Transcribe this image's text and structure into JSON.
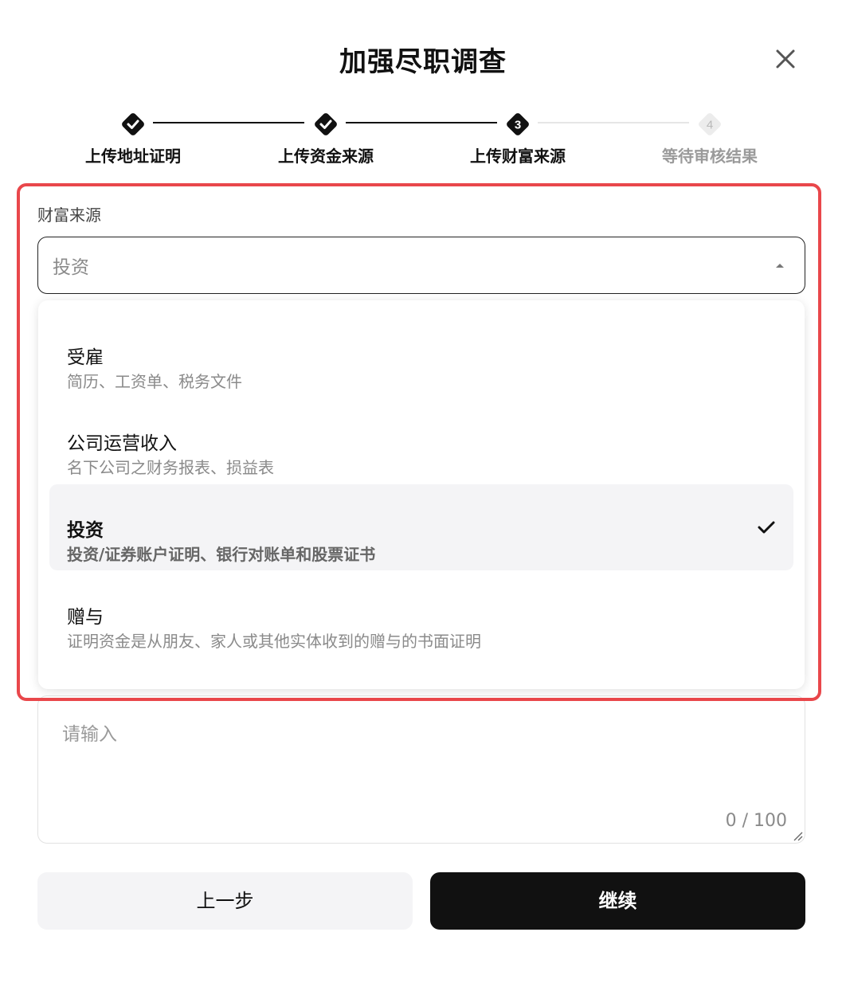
{
  "dialog": {
    "title": "加强尽职调查"
  },
  "stepper": {
    "steps": [
      {
        "label": "上传地址证明",
        "state": "done"
      },
      {
        "label": "上传资金来源",
        "state": "done"
      },
      {
        "label": "上传财富来源",
        "state": "current",
        "number": "3"
      },
      {
        "label": "等待审核结果",
        "state": "pending",
        "number": "4"
      }
    ]
  },
  "form": {
    "field_label": "财富来源",
    "selected_value": "投资",
    "options": [
      {
        "title": "受雇",
        "desc": "简历、工资单、税务文件",
        "selected": false
      },
      {
        "title": "公司运营收入",
        "desc": "名下公司之财务报表、损益表",
        "selected": false
      },
      {
        "title": "投资",
        "desc": "投资/证券账户证明、银行对账单和股票证书",
        "selected": true
      },
      {
        "title": "赠与",
        "desc": "证明资金是从朋友、家人或其他实体收到的赠与的书面证明",
        "selected": false
      }
    ],
    "textarea_placeholder": "请输入",
    "textarea_counter": "0 / 100"
  },
  "buttons": {
    "prev_label": "上一步",
    "next_label": "继续"
  },
  "colors": {
    "highlight_border": "#e9474b",
    "primary_button": "#111111",
    "secondary_button": "#f4f4f6",
    "selected_option_bg": "#f4f4f6"
  },
  "icons": {
    "close": "close-icon",
    "step_done": "check-diamond-icon",
    "caret": "caret-up-icon",
    "selected": "check-icon",
    "resize": "resize-handle-icon"
  }
}
